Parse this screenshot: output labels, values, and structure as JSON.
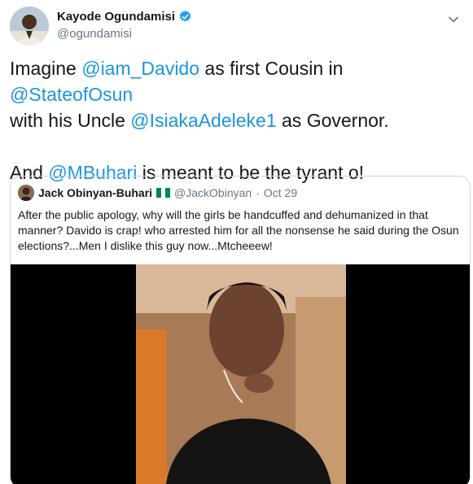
{
  "author": {
    "display_name": "Kayode Ogundamisi",
    "handle": "@ogundamisi",
    "verified": true
  },
  "tweet": {
    "line1_prefix": "Imagine ",
    "mention_davido": "@iam_Davido",
    "line1_mid": " as first Cousin in ",
    "mention_osun": "@StateofOsun",
    "line2_prefix": " with his Uncle ",
    "mention_adeleke": "@IsiakaAdeleke1",
    "line2_suffix": " as Governor.",
    "line3_prefix": "And ",
    "mention_buhari": "@MBuhari",
    "line3_suffix": " is meant to be the tyrant o!"
  },
  "quoted_tweet": {
    "display_name": "Jack Obinyan-Buhari",
    "flag": "Nigeria flag",
    "handle": "@JackObinyan",
    "separator": "·",
    "date": "Oct 29",
    "text": "After the public apology, why will the girls be handcuffed and dehumanized in that manner?  Davido is crap! who arrested him for all the nonsense he said during the Osun elections?...Men I dislike this guy now...Mtcheeew!"
  },
  "colors": {
    "link": "#1b95e0",
    "secondary": "#657786",
    "border": "#ccd6dd",
    "verified": "#1da1f2"
  }
}
